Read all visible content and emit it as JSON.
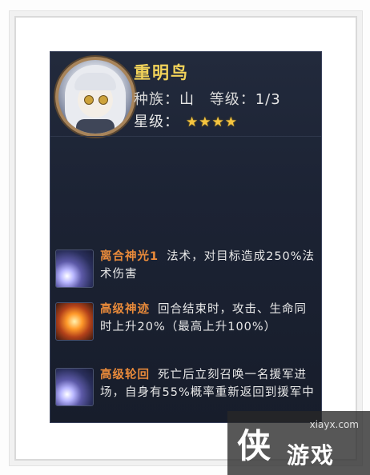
{
  "hero": {
    "name": "重明鸟",
    "race_label": "种族：",
    "race_value": "山",
    "level_label": "等级：",
    "level_value": "1/3",
    "star_label": "星级：",
    "stars": "★★★★",
    "star_count": 4
  },
  "skills": [
    {
      "name": "离合神光1",
      "desc": "法术，对目标造成250%法术伤害",
      "icon": "light-slash-icon"
    },
    {
      "name": "高级神迹",
      "desc": "回合结束时，攻击、生命同时上升20%（最高上升100%）",
      "icon": "burst-icon"
    },
    {
      "name": "高级轮回",
      "desc": "死亡后立刻召唤一名援军进场，自身有55%概率重新返回到援军中",
      "icon": "light-slash-icon"
    }
  ],
  "watermark": {
    "site": "xiayx.com",
    "glyph": "侠",
    "brand": "游戏"
  },
  "colors": {
    "panel_bg": "#1c2334",
    "name": "#f2d35a",
    "skill_name": "#e98a3a",
    "star": "#f5c540"
  }
}
